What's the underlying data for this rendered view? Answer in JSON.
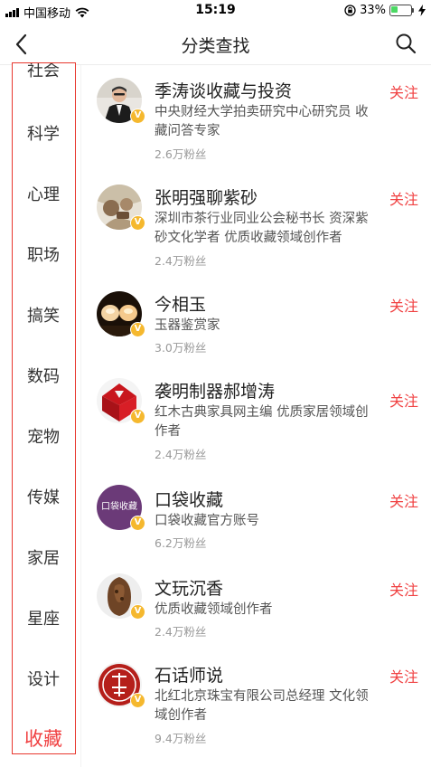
{
  "status_bar": {
    "carrier": "中国移动",
    "time": "15:19",
    "battery_percent": "33%",
    "battery_level": 0.33,
    "battery_color": "#4cd964"
  },
  "nav": {
    "title": "分类查找",
    "back_icon": "chevron-left-icon",
    "search_icon": "search-icon"
  },
  "sidebar": {
    "active_color": "#f04142",
    "items": [
      {
        "label": "社会"
      },
      {
        "label": "科学"
      },
      {
        "label": "心理"
      },
      {
        "label": "职场"
      },
      {
        "label": "搞笑"
      },
      {
        "label": "数码"
      },
      {
        "label": "宠物"
      },
      {
        "label": "传媒"
      },
      {
        "label": "家居"
      },
      {
        "label": "星座"
      },
      {
        "label": "设计"
      },
      {
        "label": "收藏",
        "active": true
      }
    ]
  },
  "users": [
    {
      "name": "季涛谈收藏与投资",
      "desc": "中央财经大学拍卖研究中心研究员 收藏问答专家",
      "fans": "2.6万粉丝",
      "follow": "关注",
      "verified": "V"
    },
    {
      "name": "张明强聊紫砂",
      "desc": "深圳市茶行业同业公会秘书长 资深紫砂文化学者 优质收藏领域创作者",
      "fans": "2.4万粉丝",
      "follow": "关注",
      "verified": "V"
    },
    {
      "name": "今相玉",
      "desc": "玉器鉴赏家",
      "fans": "3.0万粉丝",
      "follow": "关注",
      "verified": "V"
    },
    {
      "name": "袭明制器郝增涛",
      "desc": "红木古典家具网主编 优质家居领域创作者",
      "fans": "2.4万粉丝",
      "follow": "关注",
      "verified": "V"
    },
    {
      "name": "口袋收藏",
      "desc": "口袋收藏官方账号",
      "fans": "6.2万粉丝",
      "follow": "关注",
      "verified": "V",
      "avatar_text": "口袋收藏"
    },
    {
      "name": "文玩沉香",
      "desc": "优质收藏领域创作者",
      "fans": "2.4万粉丝",
      "follow": "关注",
      "verified": "V"
    },
    {
      "name": "石话师说",
      "desc": "北红北京珠宝有限公司总经理 文化领域创作者",
      "fans": "9.4万粉丝",
      "follow": "关注",
      "verified": "V"
    }
  ]
}
